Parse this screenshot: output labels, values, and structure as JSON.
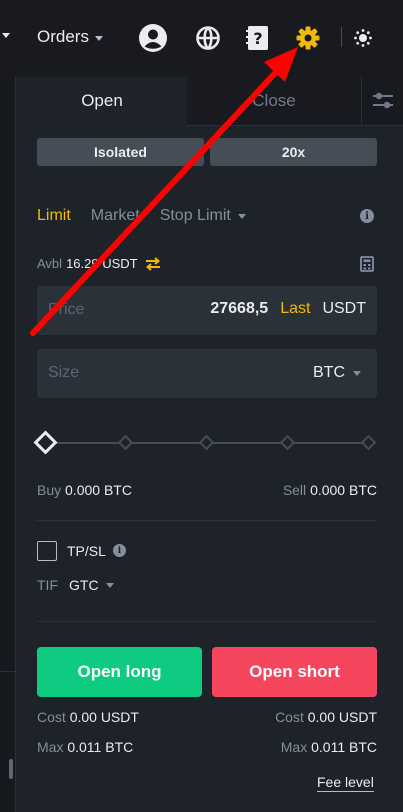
{
  "header": {
    "orders_label": "Orders",
    "icons": [
      "chevron-down-icon",
      "user-icon",
      "globe-icon",
      "help-icon",
      "gear-icon",
      "theme-icon"
    ]
  },
  "tabs": {
    "open": "Open",
    "close": "Close"
  },
  "margin": {
    "mode": "Isolated",
    "leverage": "20x"
  },
  "order_types": {
    "limit": "Limit",
    "market": "Market",
    "stop_limit": "Stop Limit",
    "active": "Limit"
  },
  "avbl": {
    "label": "Avbl",
    "value": "16.29 USDT"
  },
  "price": {
    "placeholder": "Price",
    "value": "27668,5",
    "last": "Last",
    "unit": "USDT"
  },
  "size": {
    "placeholder": "Size",
    "unit": "BTC"
  },
  "slider": {
    "level_percent": 0,
    "ticks": 5
  },
  "buy": {
    "label": "Buy",
    "value": "0.000 BTC"
  },
  "sell": {
    "label": "Sell",
    "value": "0.000 BTC"
  },
  "tpsl": {
    "label": "TP/SL",
    "checked": false
  },
  "tif": {
    "label": "TIF",
    "value": "GTC"
  },
  "actions": {
    "open_long": "Open long",
    "open_short": "Open short"
  },
  "cost_long": {
    "label": "Cost",
    "value": "0.00 USDT"
  },
  "cost_short": {
    "label": "Cost",
    "value": "0.00 USDT"
  },
  "max_long": {
    "label": "Max",
    "value": "0.011 BTC"
  },
  "max_short": {
    "label": "Max",
    "value": "0.011 BTC"
  },
  "fee_level": "Fee level",
  "colors": {
    "accent": "#f0b90b",
    "long": "#0ecb81",
    "short": "#f6465d",
    "annotation_arrow": "#ff0000"
  }
}
